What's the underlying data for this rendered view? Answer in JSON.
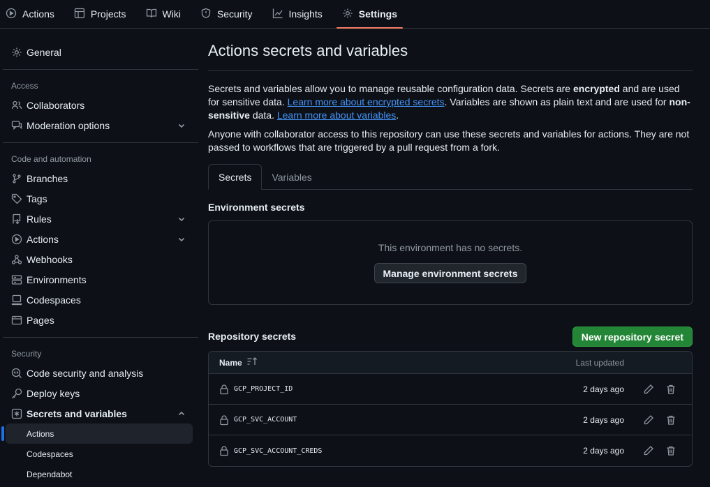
{
  "topnav": {
    "tabs": [
      {
        "label": "Actions",
        "icon": "play-circle-icon"
      },
      {
        "label": "Projects",
        "icon": "table-icon"
      },
      {
        "label": "Wiki",
        "icon": "book-icon"
      },
      {
        "label": "Security",
        "icon": "shield-icon"
      },
      {
        "label": "Insights",
        "icon": "graph-icon"
      },
      {
        "label": "Settings",
        "icon": "gear-icon",
        "active": true
      }
    ]
  },
  "sidebar": {
    "general": "General",
    "access_heading": "Access",
    "collaborators": "Collaborators",
    "moderation": "Moderation options",
    "code_heading": "Code and automation",
    "branches": "Branches",
    "tags": "Tags",
    "rules": "Rules",
    "actions": "Actions",
    "webhooks": "Webhooks",
    "environments": "Environments",
    "codespaces": "Codespaces",
    "pages": "Pages",
    "security_heading": "Security",
    "code_security": "Code security and analysis",
    "deploy_keys": "Deploy keys",
    "secrets_vars": "Secrets and variables",
    "sub_actions": "Actions",
    "sub_codespaces": "Codespaces",
    "sub_dependabot": "Dependabot"
  },
  "main": {
    "title": "Actions secrets and variables",
    "intro": {
      "p1_a": "Secrets and variables allow you to manage reusable configuration data. Secrets are ",
      "p1_b": "encrypted",
      "p1_c": " and are used for sensitive data. ",
      "p1_link1": "Learn more about encrypted secrets",
      "p1_d": ". Variables are shown as plain text and are used for ",
      "p1_e": "non-sensitive",
      "p1_f": " data. ",
      "p1_link2": "Learn more about variables",
      "p1_g": ".",
      "p2": "Anyone with collaborator access to this repository can use these secrets and variables for actions. They are not passed to workflows that are triggered by a pull request from a fork."
    },
    "subtabs": {
      "secrets": "Secrets",
      "variables": "Variables"
    },
    "env_title": "Environment secrets",
    "env_empty": "This environment has no secrets.",
    "env_button": "Manage environment secrets",
    "repo_title": "Repository secrets",
    "new_button": "New repository secret",
    "table": {
      "col_name": "Name",
      "col_updated": "Last updated",
      "rows": [
        {
          "name": "GCP_PROJECT_ID",
          "updated": "2 days ago"
        },
        {
          "name": "GCP_SVC_ACCOUNT",
          "updated": "2 days ago"
        },
        {
          "name": "GCP_SVC_ACCOUNT_CREDS",
          "updated": "2 days ago"
        }
      ]
    }
  },
  "colors": {
    "accent": "#4493f8",
    "primary": "#238636",
    "tab_underline": "#f78166",
    "bg": "#0d1117"
  }
}
